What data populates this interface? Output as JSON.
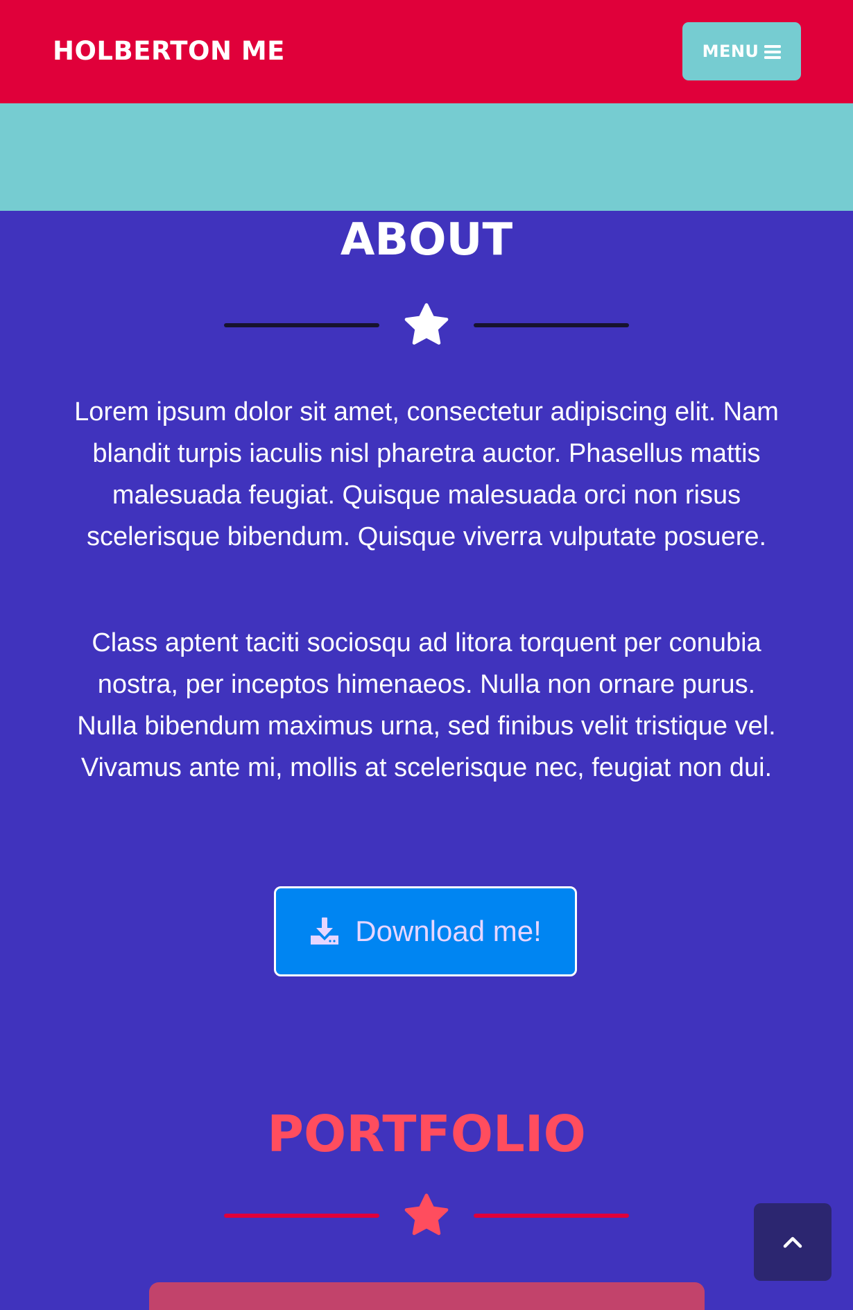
{
  "navbar": {
    "brand": "HOLBERTON ME",
    "menu_label": "MENU",
    "menu_icon": "bars-icon",
    "background": "#e0003a",
    "menu_background": "#76ccd1"
  },
  "about": {
    "title": "ABOUT",
    "divider_icon": "star-icon",
    "paragraphs": [
      "Lorem ipsum dolor sit amet, consectetur adipiscing elit. Nam blandit turpis iaculis nisl pharetra auctor. Phasellus mattis malesuada feugiat. Quisque malesuada orci non risus scelerisque bibendum. Quisque viverra vulputate posuere.",
      "Class aptent taciti sociosqu ad litora torquent per conubia nostra, per inceptos himenaeos. Nulla non ornare purus. Nulla bibendum maximus urna, sed finibus velit tristique vel. Vivamus ante mi, mollis at scelerisque nec, feugiat non dui."
    ],
    "download_label": "Download me!",
    "download_icon": "download-icon",
    "background": "#4033bd"
  },
  "portfolio": {
    "title": "PORTFOLIO",
    "divider_icon": "star-icon",
    "accent": "#ff4d5e"
  },
  "scroll_top": {
    "icon": "chevron-up-icon"
  }
}
